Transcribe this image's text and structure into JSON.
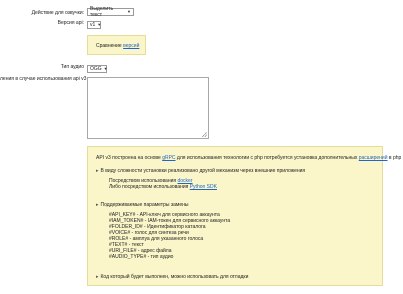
{
  "form": {
    "action_label": "Действие для озвучки:",
    "action_value": "Выделить текст",
    "api_version_label": "Версия api:",
    "api_version_value": "v1",
    "comparison_text": "Сравнение ",
    "comparison_link": "версий",
    "voice_type_label": "Тип аудио",
    "voice_type_value": "OGG",
    "cut_label": "ления в случае использования api v3:"
  },
  "info": {
    "intro_text_1": "API v3 построена на основе ",
    "intro_link_1": "gRPC",
    "intro_text_2": " для использования технологии с php потребуется установка дополнительных ",
    "intro_link_2": "расширений",
    "intro_text_3": " в php",
    "section1_title": "В виду сложности установки реализовано другой механизм через внешние приложения",
    "section1_line1_text": "Посредством использования ",
    "section1_line1_link": "docker",
    "section1_line2_text": "Либо посредством использования ",
    "section1_line2_link": "Python SDK",
    "section2_title": "Поддерживаемые параметры замены",
    "params": [
      "#API_KEY# - API-ключ для сервисного аккаунта",
      "#IAM_TOKEN# - IAM-токен для сервисного аккаунта",
      "#FOLDER_ID# - Идентификатор каталога",
      "#VOICE# - голос для синтеза речи",
      "#ROLE# - амплуа для указанного голоса",
      "#TEXT# - текст",
      "#URI_FILE# - адрес файла",
      "#AUDIO_TYPE# - тип аудио"
    ],
    "section3_title": "Код который будет выполнен, можно использовать для отладки"
  }
}
